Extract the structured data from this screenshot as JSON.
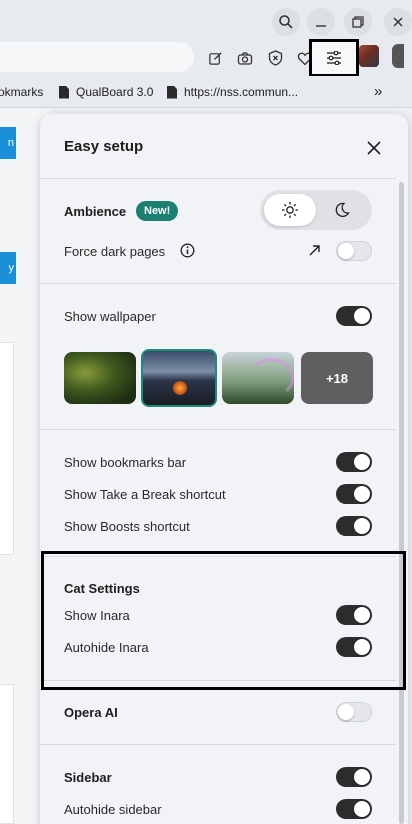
{
  "browser": {
    "bookmarks": [
      {
        "label": "okmarks",
        "icon": "none"
      },
      {
        "label": "QualBoard 3.0",
        "icon": "doc-icon"
      },
      {
        "label": "https://nss.commun...",
        "icon": "doc-icon"
      }
    ],
    "more_symbol": "»",
    "toolbar_icons": [
      "edit-icon",
      "camera-icon",
      "shield-icon",
      "heart-icon",
      "easy-setup-icon",
      "avatar",
      "sidebar-icon"
    ]
  },
  "background_page": {
    "button1_text": "n",
    "button2_text": "y"
  },
  "panel": {
    "title": "Easy setup",
    "ambience": {
      "label": "Ambience",
      "badge": "New!"
    },
    "force_dark": {
      "label": "Force dark pages",
      "enabled": false
    },
    "wallpaper": {
      "label": "Show wallpaper",
      "enabled": true,
      "more_label": "+18"
    },
    "bookmarks_bar": {
      "label": "Show bookmarks bar",
      "enabled": true
    },
    "take_break": {
      "label": "Show Take a Break shortcut",
      "enabled": true
    },
    "boosts": {
      "label": "Show Boosts shortcut",
      "enabled": true
    },
    "cat": {
      "heading": "Cat Settings",
      "show_inara": "Show Inara",
      "autohide_inara": "Autohide Inara"
    },
    "opera_ai": {
      "label": "Opera AI",
      "enabled": false
    },
    "sidebar": {
      "label": "Sidebar",
      "autohide": "Autohide sidebar"
    }
  },
  "colors": {
    "accent": "#1b7f71",
    "toggle_on": "#2c2c2c",
    "bg_blue": "#1a8fd7"
  }
}
